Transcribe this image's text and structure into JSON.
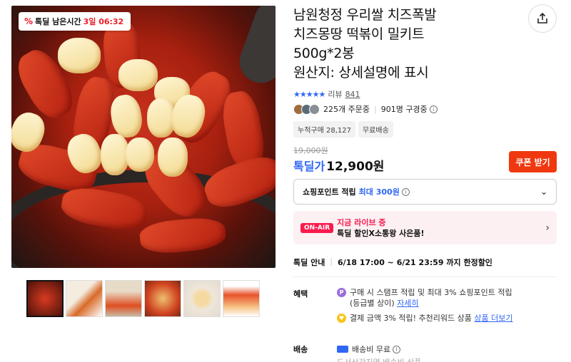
{
  "timer_badge": {
    "prefix": "%",
    "label": "톡딜 남은시간",
    "remaining": "3일 06:32"
  },
  "product": {
    "title_lines": [
      "남원청정 우리쌀 치즈폭발",
      "치즈몽땅 떡볶이 밀키트",
      "500g*2봉",
      "원산지: 상세설명에 표시"
    ]
  },
  "rating": {
    "stars": "★★★★★",
    "label": "리뷰",
    "count": "841"
  },
  "stats": {
    "orders": "225개 주문중",
    "subscribers": "901명 구경중"
  },
  "tags": [
    "누적구매 28,127",
    "무료배송"
  ],
  "price": {
    "original": "19,000원",
    "sale_label": "톡딜가",
    "sale": "12,900원"
  },
  "coupon_button": "쿠폰 받기",
  "points": {
    "label": "쇼핑포인트 적립",
    "highlight": "최대 300원"
  },
  "live": {
    "badge": "ON-AIR",
    "line1": "지금 라이브 중",
    "line2": "톡딜 할인X소통왕 사은품!"
  },
  "deal": {
    "label": "톡딜 안내",
    "period": "6/18 17:00 ~ 6/21 23:59 까지 한정할인"
  },
  "benefit": {
    "label": "혜택",
    "line1": "구매 시 스탬프 적립 및 최대 3% 쇼핑포인트 적립",
    "line1b": "(등급별 상이)",
    "line1_link": "자세히",
    "line2": "결제 금액 3% 적립! 추천리워드 상품",
    "line2_link": "상품 더보기"
  },
  "shipping": {
    "label": "배송",
    "value": "배송비 무료",
    "sub": "도서산간지역 배송비 상품"
  },
  "thumbnails": [
    "thumb-1",
    "thumb-2",
    "thumb-3",
    "thumb-4",
    "thumb-5",
    "thumb-6"
  ],
  "colors": {
    "accent_blue": "#2f66f6",
    "coupon_orange": "#f03810",
    "live_pink": "#fa1b4d",
    "timer_red": "#ee1c25"
  },
  "icons": {
    "share": "share-icon",
    "chevron": "chevron-down-icon",
    "truck": "truck-icon"
  }
}
